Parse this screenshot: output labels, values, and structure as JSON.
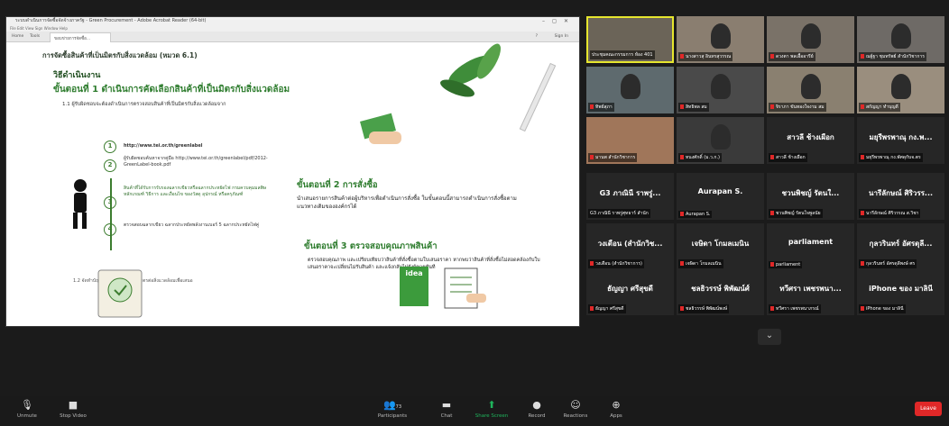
{
  "reader": {
    "title": "ระบบดำเนินการจัดซื้อจัดจ้างภาครัฐ - Green Procurement - Adobe Acrobat Reader (64-bit)",
    "menu": "File  Edit  View  Sign  Window  Help",
    "tab_home": "Home",
    "tab_tools": "Tools",
    "tab_doc": "ขอบข่ายการจัดซื้อ...",
    "sign_in": "Sign In",
    "help": "?"
  },
  "doc": {
    "title": "การจัดซื้อสินค้าที่เป็นมิตรกับสิ่งแวดล้อม (หมวด 6.1)",
    "section": "วิธีดำเนินงาน",
    "step1": "ขั้นตอนที่ 1 ดำเนินการคัดเลือกสินค้าที่เป็นมิตรกับสิ่งแวดล้อม",
    "step1_1": "1.1 ผู้รับผิดชอบจะต้องดำเนินการตรวจสอบสินค้าที่เป็นมิตรกับสิ่งแวดล้อมจาก",
    "items": [
      {
        "num": "1",
        "text": "http://www.tei.or.th/greenlabel"
      },
      {
        "num": "2",
        "text": "ผู้รับผิดชอบค้นหาจากคู่มือ http://www.tei.or.th/greenlabel/pdf/2012-GreenLabel-book.pdf"
      },
      {
        "num": "3",
        "text": "สินค้าที่ได้รับการรับรองฉลากเขียวหรือฉลากประหยัดไฟ กรมควบคุมมลพิษ หลักเกณฑ์ วิธีการ และเงื่อนไข ของวัสดุ อุปกรณ์ หรือครุภัณฑ์"
      },
      {
        "num": "4",
        "text": "ตรวจสอบฉลากเขียว ฉลากประหยัดพลังงานเบอร์ 5 ฉลากประหยัดไฟคู่"
      }
    ],
    "step1_2": "1.2 จัดทำบัญชีรายการสินค้าที่เป็นมิตรต่อสิ่งแวดล้อมเพื่อเสนอ",
    "step2": "ขั้นตอนที่ 2 การสั่งซื้อ",
    "step2_text": "นำเสนอรายการสินค้าต่อผู้บริหารเพื่อดำเนินการสั่งซื้อ ในขั้นตอนนี้สามารถดำเนินการสั่งซื้อตามแนวทางเดิมขององค์กรได้",
    "step3": "ขั้นตอนที่ 3 ตรวจสอบคุณภาพสินค้า",
    "step3_text": "ตรวจสอบคุณภาพ และเปรียบเทียบว่าสินค้าที่สั่งซื้อตามใบเสนอราคา หากพบว่าสินค้าที่สั่งซื้อไม่สอดคล้องกับใบเสนอราคาจะเปลี่ยนไม่รับสินค้า และแจ้งกลับไปยังผู้ขายทันที",
    "idea_label": "idea"
  },
  "participants": [
    {
      "name": "ประชุมคณะกรรมการ ห้อง 401",
      "video": true
    },
    {
      "name": "นางสาวสุ อินทรสุวรรณ",
      "video": true
    },
    {
      "name": "ดวงตา พลเอื้ออารีย์",
      "video": true
    },
    {
      "name": "ณฐ์ฐา ชุมทรัพย์ สำนักวิชาการ",
      "video": true
    },
    {
      "name": "ทิพย์สุภา",
      "video": true
    },
    {
      "name": "สิทธิพล สม",
      "video": true
    },
    {
      "name": "จิราภา ขันทองใจงาม สม",
      "video": true
    },
    {
      "name": "สกัญญา ทำบุญดี",
      "video": true
    },
    {
      "name": "มานพ สำนักวิชาการ",
      "video": true
    },
    {
      "name": "ทนงศักดิ์ (ม.ว.ก.)",
      "video": true
    },
    {
      "name": "สาวลี ช้างเผือก",
      "sub": "สาวลี ช้างเผือก",
      "video": false
    },
    {
      "name": "มยุรีพรพาณุ กง.พ...",
      "sub": "มยุรีพรพาณุ กง.พัศดุกับจ.ตร",
      "video": false
    },
    {
      "name": "G3 ภาณินี ราพรู่...",
      "sub": "G3 ภาณินี ราพรู่ศุทธาร์ สำนัก",
      "video": false
    },
    {
      "name": "Aurapan S.",
      "sub": "Aurapan S.",
      "video": false
    },
    {
      "name": "ชวนพิชญ์ รัตนใ...",
      "sub": "ชวนพิชญ์ รัตนใจพูลนัย",
      "video": false
    },
    {
      "name": "นารีลักษณ์ ศิริวรร...",
      "sub": "นารีลักษณ์ ศิริวรรณ ส.วิชา",
      "video": false
    },
    {
      "name": "วงเดือน (สำนักวิช...",
      "sub": "วงเดือน (สำนักวิชาการ)",
      "video": false
    },
    {
      "name": "เจษิดา โกมลเมนิน",
      "sub": "เจษิดา โกมลเมนิน",
      "video": false
    },
    {
      "name": "parliament",
      "sub": "parliament",
      "video": false
    },
    {
      "name": "กุลวรินทร์ อัศรดุลี...",
      "sub": "กุลวรินทร์ อัศรดุลีพงษ์ ศร",
      "video": false
    },
    {
      "name": "ธัญญา ศรีสุขดี",
      "sub": "ธัญญา ศรีสุขดี",
      "video": false
    },
    {
      "name": "ชลธิวรรษ์ พิพัฒน์ศ์",
      "sub": "ชลธิวรรษ์ พิพัฒน์พงษ์",
      "video": false
    },
    {
      "name": "ทวีศรา เพชรพนา...",
      "sub": "ทวีศรา เพชรพนาภรณ์",
      "video": false
    },
    {
      "name": "iPhone ของ มาลินี",
      "sub": "iPhone ของ มาลินี",
      "video": false
    }
  ],
  "toolbar": {
    "unmute": "Unmute",
    "stop_video": "Stop Video",
    "participants": "Participants",
    "participants_count": "73",
    "chat": "Chat",
    "share_screen": "Share Screen",
    "record": "Record",
    "reactions": "Reactions",
    "apps": "Apps",
    "leave": "Leave"
  }
}
